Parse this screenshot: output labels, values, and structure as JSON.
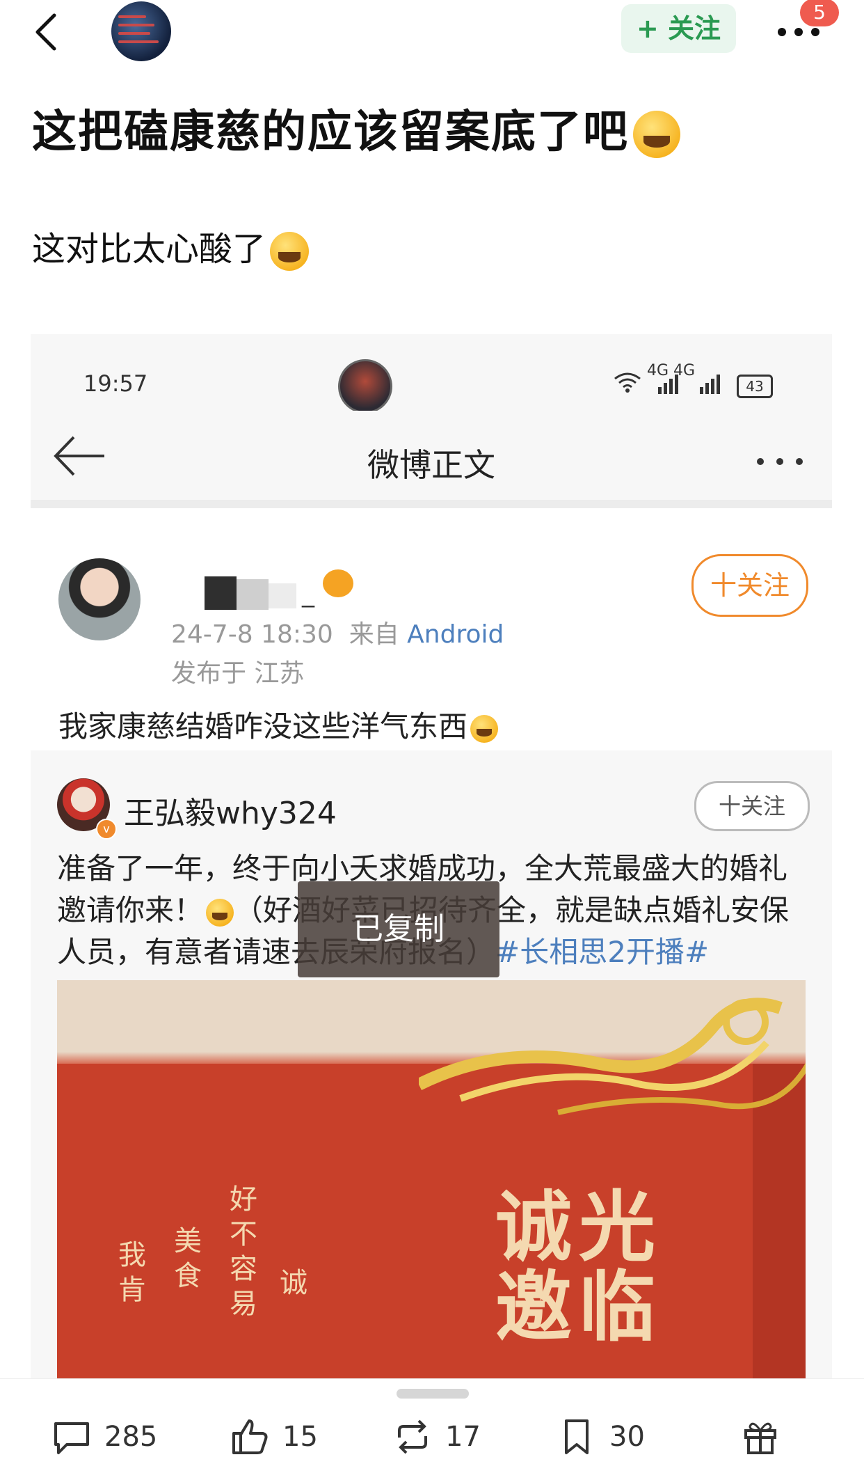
{
  "header": {
    "follow_label": "+ 关注",
    "notification_count": "5"
  },
  "post": {
    "title": "这把磕康慈的应该留案底了吧",
    "body": "这对比太心酸了"
  },
  "screenshot": {
    "status_bar": {
      "time": "19:57",
      "signal": "4G 4G",
      "battery": "43"
    },
    "nav_title": "微博正文",
    "author": {
      "name_visible": "_",
      "date": "24-7-8 18:30",
      "from_label": "来自",
      "source": "Android",
      "location": "发布于 江苏",
      "follow_label": "十关注"
    },
    "repost_text": "我家康慈结婚咋没这些洋气东西",
    "quoted": {
      "name": "王弘毅why324",
      "follow_label": "十关注",
      "vip_mark": "v",
      "text_part1": "准备了一年，终于向小夭求婚成功，全大荒最盛大的婚礼邀请你来！",
      "text_part2": "（好酒好菜已招待齐全，就是缺点婚礼安保人员，有意者请速去辰荣府报名）",
      "hashtag": "#长相思2开播#",
      "image_text": {
        "big_line1": "诚光",
        "big_line2": "邀临",
        "col1": "好不容易",
        "col2": "美食",
        "col3": "我肯",
        "col4": "诚"
      }
    },
    "toast": "已复制"
  },
  "action_bar": {
    "comments": "285",
    "likes": "15",
    "reposts": "17",
    "favorites": "30"
  }
}
